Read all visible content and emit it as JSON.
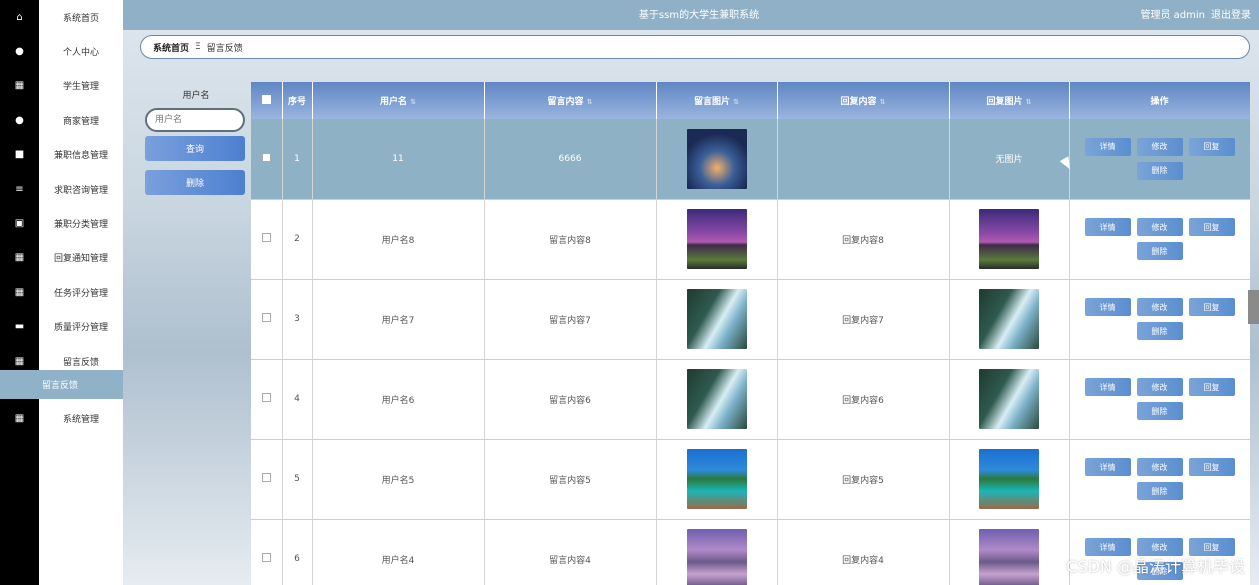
{
  "header": {
    "site_title": "基于ssm的大学生兼职系统",
    "admin_label": "管理员 admin",
    "logout": "退出登录"
  },
  "sidebar": {
    "items": [
      {
        "label": "系统首页",
        "icon": "home-icon",
        "glyph": "⌂"
      },
      {
        "label": "个人中心",
        "icon": "user-icon",
        "glyph": "●"
      },
      {
        "label": "学生管理",
        "icon": "grid-icon",
        "glyph": "▦"
      },
      {
        "label": "商家管理",
        "icon": "user-icon",
        "glyph": "●"
      },
      {
        "label": "兼职信息管理",
        "icon": "briefcase-icon",
        "glyph": "■"
      },
      {
        "label": "求职咨询管理",
        "icon": "list-icon",
        "glyph": "≡"
      },
      {
        "label": "兼职分类管理",
        "icon": "chart-icon",
        "glyph": "▣"
      },
      {
        "label": "回复通知管理",
        "icon": "grid-icon",
        "glyph": "▦"
      },
      {
        "label": "任务评分管理",
        "icon": "grid-icon",
        "glyph": "▦"
      },
      {
        "label": "质量评分管理",
        "icon": "chat-icon",
        "glyph": "▬"
      },
      {
        "label": "留言反馈",
        "icon": "grid-icon",
        "glyph": "▦"
      }
    ],
    "sub_item": "留言反馈",
    "last_item": {
      "label": "系统管理",
      "icon": "grid-icon",
      "glyph": "▦"
    }
  },
  "breadcrumb": {
    "home": "系统首页",
    "separator": "Ξ",
    "current": "留言反馈"
  },
  "search": {
    "label": "用户名",
    "placeholder": "用户名",
    "query_button": "查询",
    "delete_button": "删除"
  },
  "table": {
    "headers": {
      "index": "序号",
      "username": "用户名",
      "content": "留言内容",
      "image": "留言图片",
      "reply": "回复内容",
      "reply_image": "回复图片",
      "actions": "操作"
    },
    "rows": [
      {
        "index": "1",
        "username": "11",
        "content": "6666",
        "image": "img-sea",
        "reply": "",
        "reply_image": "",
        "reply_image_text": "无图片",
        "selected": true
      },
      {
        "index": "2",
        "username": "用户名8",
        "content": "留言内容8",
        "image": "img-purple",
        "reply": "回复内容8",
        "reply_image": "img-purple",
        "reply_image_text": ""
      },
      {
        "index": "3",
        "username": "用户名7",
        "content": "留言内容7",
        "image": "img-falls",
        "reply": "回复内容7",
        "reply_image": "img-falls",
        "reply_image_text": ""
      },
      {
        "index": "4",
        "username": "用户名6",
        "content": "留言内容6",
        "image": "img-falls",
        "reply": "回复内容6",
        "reply_image": "img-falls",
        "reply_image_text": ""
      },
      {
        "index": "5",
        "username": "用户名5",
        "content": "留言内容5",
        "image": "img-dock",
        "reply": "回复内容5",
        "reply_image": "img-dock",
        "reply_image_text": ""
      },
      {
        "index": "6",
        "username": "用户名4",
        "content": "留言内容4",
        "image": "img-mountain",
        "reply": "回复内容4",
        "reply_image": "img-mountain",
        "reply_image_text": ""
      }
    ],
    "row_actions": {
      "detail": "详情",
      "edit": "修改",
      "reply": "回复",
      "delete": "删除"
    }
  },
  "watermark": "CSDN @晶涛计算机毕设"
}
